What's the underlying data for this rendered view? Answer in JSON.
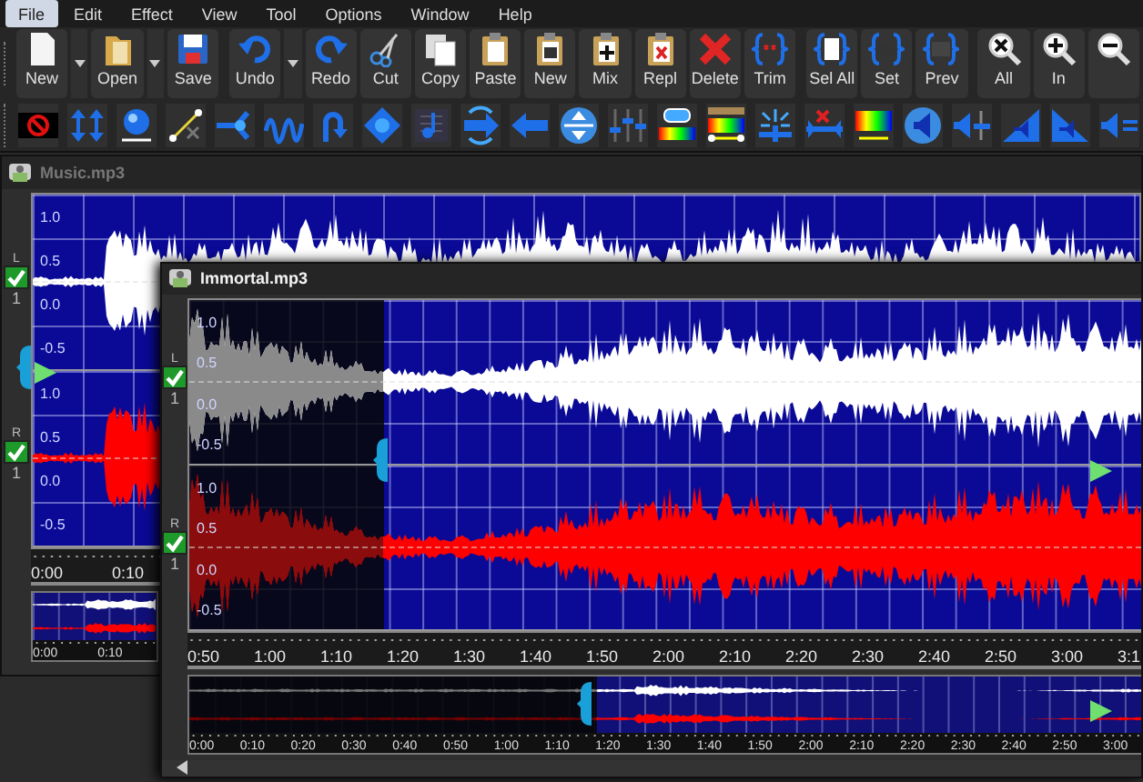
{
  "menu": [
    {
      "label": "File",
      "selected": true
    },
    {
      "label": "Edit",
      "selected": false
    },
    {
      "label": "Effect",
      "selected": false
    },
    {
      "label": "View",
      "selected": false
    },
    {
      "label": "Tool",
      "selected": false
    },
    {
      "label": "Options",
      "selected": false
    },
    {
      "label": "Window",
      "selected": false
    },
    {
      "label": "Help",
      "selected": false
    }
  ],
  "toolbar": [
    {
      "kind": "document",
      "label": "New",
      "dropdown": true
    },
    {
      "kind": "folder",
      "label": "Open",
      "dropdown": true
    },
    {
      "kind": "disk",
      "label": "Save",
      "dropdown": false,
      "group_end": true
    },
    {
      "kind": "undo",
      "label": "Undo",
      "dropdown": true
    },
    {
      "kind": "redo",
      "label": "Redo",
      "dropdown": false
    },
    {
      "kind": "scissors",
      "label": "Cut",
      "dropdown": false
    },
    {
      "kind": "copy",
      "label": "Copy",
      "dropdown": false
    },
    {
      "kind": "paste",
      "label": "Paste",
      "dropdown": false
    },
    {
      "kind": "clipboard-window",
      "label": "New",
      "dropdown": false
    },
    {
      "kind": "clipboard-plus",
      "label": "Mix",
      "dropdown": false
    },
    {
      "kind": "clipboard-cross",
      "label": "Repl",
      "dropdown": false
    },
    {
      "kind": "cross",
      "label": "Delete",
      "dropdown": false
    },
    {
      "kind": "braces-cross",
      "label": "Trim",
      "dropdown": false,
      "group_end": true
    },
    {
      "kind": "braces-page",
      "label": "Sel All",
      "dropdown": false
    },
    {
      "kind": "braces-box",
      "label": "Set",
      "dropdown": false
    },
    {
      "kind": "braces-dark",
      "label": "Prev",
      "dropdown": false,
      "group_end": true
    },
    {
      "kind": "magnifier-cross",
      "label": "All",
      "dropdown": false
    },
    {
      "kind": "magnifier-plus",
      "label": "In",
      "dropdown": false
    },
    {
      "kind": "magnifier-minus",
      "dropdown": false
    }
  ],
  "effects_toolbar": [
    {
      "kind": "stop"
    },
    {
      "kind": "arrows"
    },
    {
      "kind": "sphere"
    },
    {
      "kind": "line"
    },
    {
      "kind": "split-arrow"
    },
    {
      "kind": "wave"
    },
    {
      "kind": "u-turn-arrow"
    },
    {
      "kind": "diamond"
    },
    {
      "kind": "music-note"
    },
    {
      "kind": "swap-arrows"
    },
    {
      "kind": "left-arrow"
    },
    {
      "kind": "circle-arrows"
    },
    {
      "kind": "sliders"
    },
    {
      "kind": "gradient"
    },
    {
      "kind": "spectrum"
    },
    {
      "kind": "sparkle"
    },
    {
      "kind": "cross-line"
    },
    {
      "kind": "spectrum-bar"
    },
    {
      "kind": "speaker-circle"
    },
    {
      "kind": "speaker-minus"
    },
    {
      "kind": "ramp-up"
    },
    {
      "kind": "ramp-down"
    },
    {
      "kind": "speaker-lines"
    }
  ],
  "windows": [
    {
      "title": "Music.mp3",
      "active": false,
      "channels": [
        {
          "label": "L",
          "checked": true,
          "number": "1",
          "color": "#ffffff",
          "y_labels": [
            "1.0",
            "0.5",
            "0.0",
            "-0.5"
          ]
        },
        {
          "label": "R",
          "checked": true,
          "number": "1",
          "color": "#ff0000",
          "y_labels": [
            "1.0",
            "0.5",
            "0.0",
            "-0.5"
          ]
        }
      ],
      "time_axis": [
        "0:00",
        "0:10"
      ],
      "overview_axis": [
        "0:00",
        "0:10"
      ]
    },
    {
      "title": "Immortal.mp3",
      "active": true,
      "channels": [
        {
          "label": "L",
          "checked": true,
          "number": "1",
          "color": "#ffffff",
          "y_labels": [
            "1.0",
            "0.5",
            "0.0",
            "-0.5"
          ]
        },
        {
          "label": "R",
          "checked": true,
          "number": "1",
          "color": "#ff0000",
          "y_labels": [
            "1.0",
            "0.5",
            "0.0",
            "-0.5"
          ]
        }
      ],
      "time_axis": [
        "0:50",
        "1:00",
        "1:10",
        "1:20",
        "1:30",
        "1:40",
        "1:50",
        "2:00",
        "2:10",
        "2:20",
        "2:30",
        "2:40",
        "2:50",
        "3:00",
        "3:1"
      ],
      "overview_axis": [
        "0:00",
        "0:10",
        "0:20",
        "0:30",
        "0:40",
        "0:50",
        "1:00",
        "1:10",
        "1:20",
        "1:30",
        "1:40",
        "1:50",
        "2:00",
        "2:10",
        "2:20",
        "2:30",
        "2:40",
        "2:50",
        "3:00"
      ]
    }
  ]
}
